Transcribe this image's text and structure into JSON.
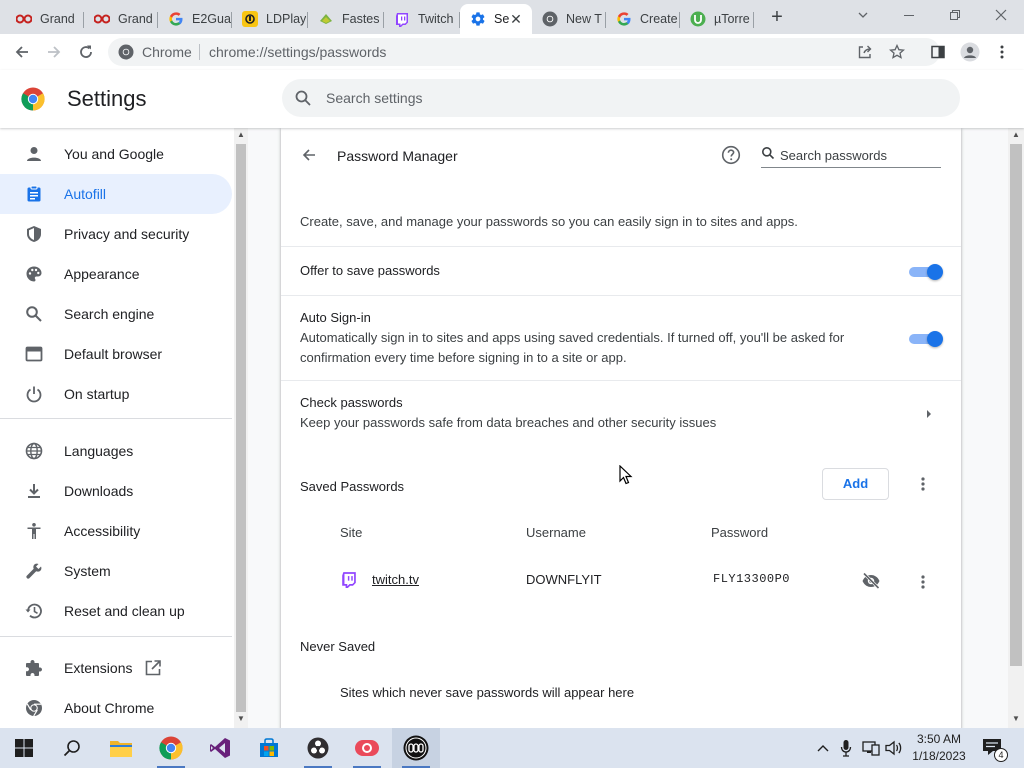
{
  "browser": {
    "tabs": [
      {
        "title": "Grand",
        "icon": "red-glasses-icon"
      },
      {
        "title": "Grand",
        "icon": "red-glasses-icon"
      },
      {
        "title": "E2Gua",
        "icon": "google-g-icon"
      },
      {
        "title": "LDPlay",
        "icon": "ldplayer-icon"
      },
      {
        "title": "Fastes",
        "icon": "fast-icon"
      },
      {
        "title": "Twitch",
        "icon": "twitch-icon"
      },
      {
        "title": "Se",
        "icon": "settings-gear-icon",
        "active": true
      },
      {
        "title": "New T",
        "icon": "chrome-icon"
      },
      {
        "title": "Create",
        "icon": "google-g-icon"
      },
      {
        "title": "µTorre",
        "icon": "utorrent-icon"
      }
    ],
    "omnibox": {
      "chip_label": "Chrome",
      "url": "chrome://settings/passwords"
    }
  },
  "settings": {
    "title": "Settings",
    "search_placeholder": "Search settings",
    "nav": [
      {
        "label": "You and Google",
        "icon": "person-icon"
      },
      {
        "label": "Autofill",
        "icon": "clipboard-icon",
        "selected": true
      },
      {
        "label": "Privacy and security",
        "icon": "shield-icon"
      },
      {
        "label": "Appearance",
        "icon": "palette-icon"
      },
      {
        "label": "Search engine",
        "icon": "search-icon"
      },
      {
        "label": "Default browser",
        "icon": "browser-window-icon"
      },
      {
        "label": "On startup",
        "icon": "power-icon"
      },
      {
        "label": "Languages",
        "icon": "globe-icon"
      },
      {
        "label": "Downloads",
        "icon": "download-icon"
      },
      {
        "label": "Accessibility",
        "icon": "accessibility-icon"
      },
      {
        "label": "System",
        "icon": "wrench-icon"
      },
      {
        "label": "Reset and clean up",
        "icon": "history-icon"
      },
      {
        "label": "Extensions",
        "icon": "puzzle-icon"
      },
      {
        "label": "About Chrome",
        "icon": "chrome-icon"
      }
    ]
  },
  "password_manager": {
    "title": "Password Manager",
    "search_placeholder": "Search passwords",
    "description": "Create, save, and manage your passwords so you can easily sign in to sites and apps.",
    "offer_to_save": {
      "label": "Offer to save passwords",
      "enabled": true
    },
    "auto_signin": {
      "label": "Auto Sign-in",
      "description_line1": "Automatically sign in to sites and apps using saved credentials. If turned off, you'll be asked for",
      "description_line2": "confirmation every time before signing in to a site or app.",
      "enabled": true
    },
    "check_passwords": {
      "label": "Check passwords",
      "description": "Keep your passwords safe from data breaches and other security issues"
    },
    "saved_passwords": {
      "heading": "Saved Passwords",
      "add_label": "Add",
      "columns": {
        "site": "Site",
        "username": "Username",
        "password": "Password"
      },
      "entries": [
        {
          "site": "twitch.tv",
          "username": "DOWNFLYIT",
          "password": "FLY13300P0",
          "icon": "twitch-icon"
        }
      ]
    },
    "never_saved": {
      "heading": "Never Saved",
      "empty_text": "Sites which never save passwords will appear here"
    }
  },
  "taskbar": {
    "time": "3:50 AM",
    "date": "1/18/2023",
    "notification_count": "4"
  },
  "colors": {
    "accent": "#1a73e8",
    "selected_bg": "#e8f0fe",
    "twitch": "#9146ff"
  }
}
